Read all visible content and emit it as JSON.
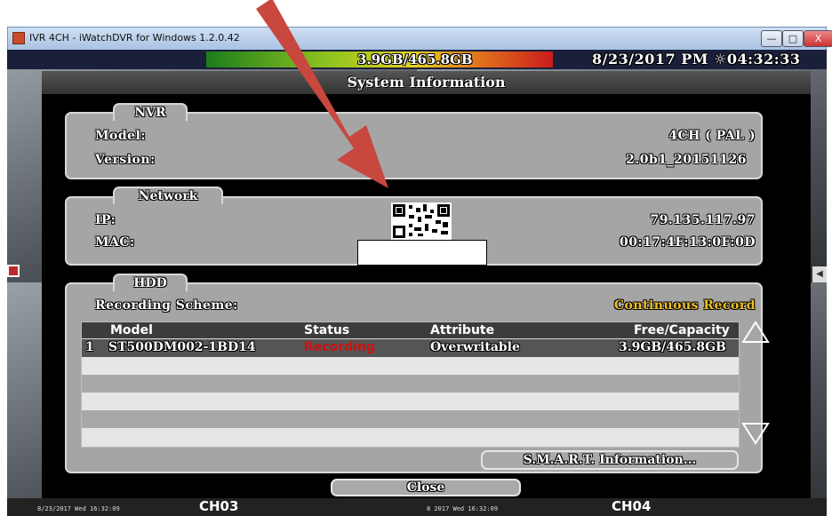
{
  "window": {
    "title": "IVR 4CH - iWatchDVR for Windows 1.2.0.42",
    "minimize_glyph": "—",
    "maximize_glyph": "□",
    "close_glyph": "X"
  },
  "statusbar": {
    "hdd_usage": "3.9GB/465.8GB",
    "datetime": "8/23/2017 PM ☼04:32:33"
  },
  "dialog": {
    "title": "System Information",
    "nvr": {
      "section_label": "NVR",
      "model_label": "Model:",
      "model_value": "4CH ( PAL )",
      "version_label": "Version:",
      "version_value": "2.0b1_20151126"
    },
    "network": {
      "section_label": "Network",
      "ip_label": "IP:",
      "ip_value": "79.135.117.97",
      "mac_label": "MAC:",
      "mac_value": "00:17:4F:13:0F:0D"
    },
    "hdd": {
      "section_label": "HDD",
      "scheme_label": "Recording Scheme:",
      "scheme_value": "Continuous Record",
      "columns": [
        "Model",
        "Status",
        "Attribute",
        "Free/Capacity"
      ],
      "rows": [
        {
          "index": "1",
          "model": "ST500DM002-1BD14",
          "status": "Recording",
          "attribute": "Overwritable",
          "capacity": "3.9GB/465.8GB"
        }
      ],
      "smart_button": "S.M.A.R.T. Information..."
    },
    "close_button": "Close"
  },
  "channels": {
    "ch03": "CH03",
    "ch04": "CH04",
    "ts_left": "8/23/2017 Wed 16:32:09",
    "ts_right": "8 2017 Wed 16:32:09"
  },
  "colors": {
    "panel_gray": "#a5a5a5",
    "accent_gold": "#f0c020",
    "status_red": "#d01010",
    "arrow_red": "#c8473e"
  },
  "icons": [
    "app-icon",
    "film-icon",
    "speaker-icon",
    "up-arrow-icon",
    "down-arrow-icon",
    "qr-code-icon",
    "annotation-arrow-icon"
  ]
}
